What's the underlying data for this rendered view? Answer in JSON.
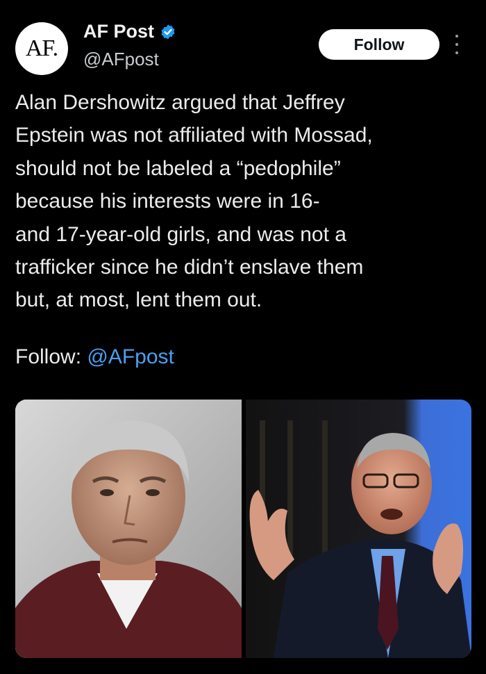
{
  "author": {
    "avatar_text": "AF.",
    "name": "AF Post",
    "handle": "@AFpost",
    "verified": true
  },
  "actions": {
    "follow_label": "Follow"
  },
  "post": {
    "lines": [
      "Alan Dershowitz argued that Jeffrey",
      "Epstein was not affiliated with Mossad,",
      "should not be labeled a “pedophile”",
      "because his interests were in 16-",
      "and 17-year-old girls, and was not a",
      "trafficker since he didn’t enslave them",
      "but, at most, lent them out."
    ],
    "follow_prefix": "Follow:",
    "follow_mention": "@AFpost"
  },
  "media": {
    "images": [
      "man-portrait-photo",
      "speaker-gesturing-photo"
    ]
  },
  "colors": {
    "background": "#000000",
    "text": "#ececec",
    "mention": "#4a9ff0",
    "verified": "#1d9bf0",
    "button_bg": "#ffffff"
  }
}
